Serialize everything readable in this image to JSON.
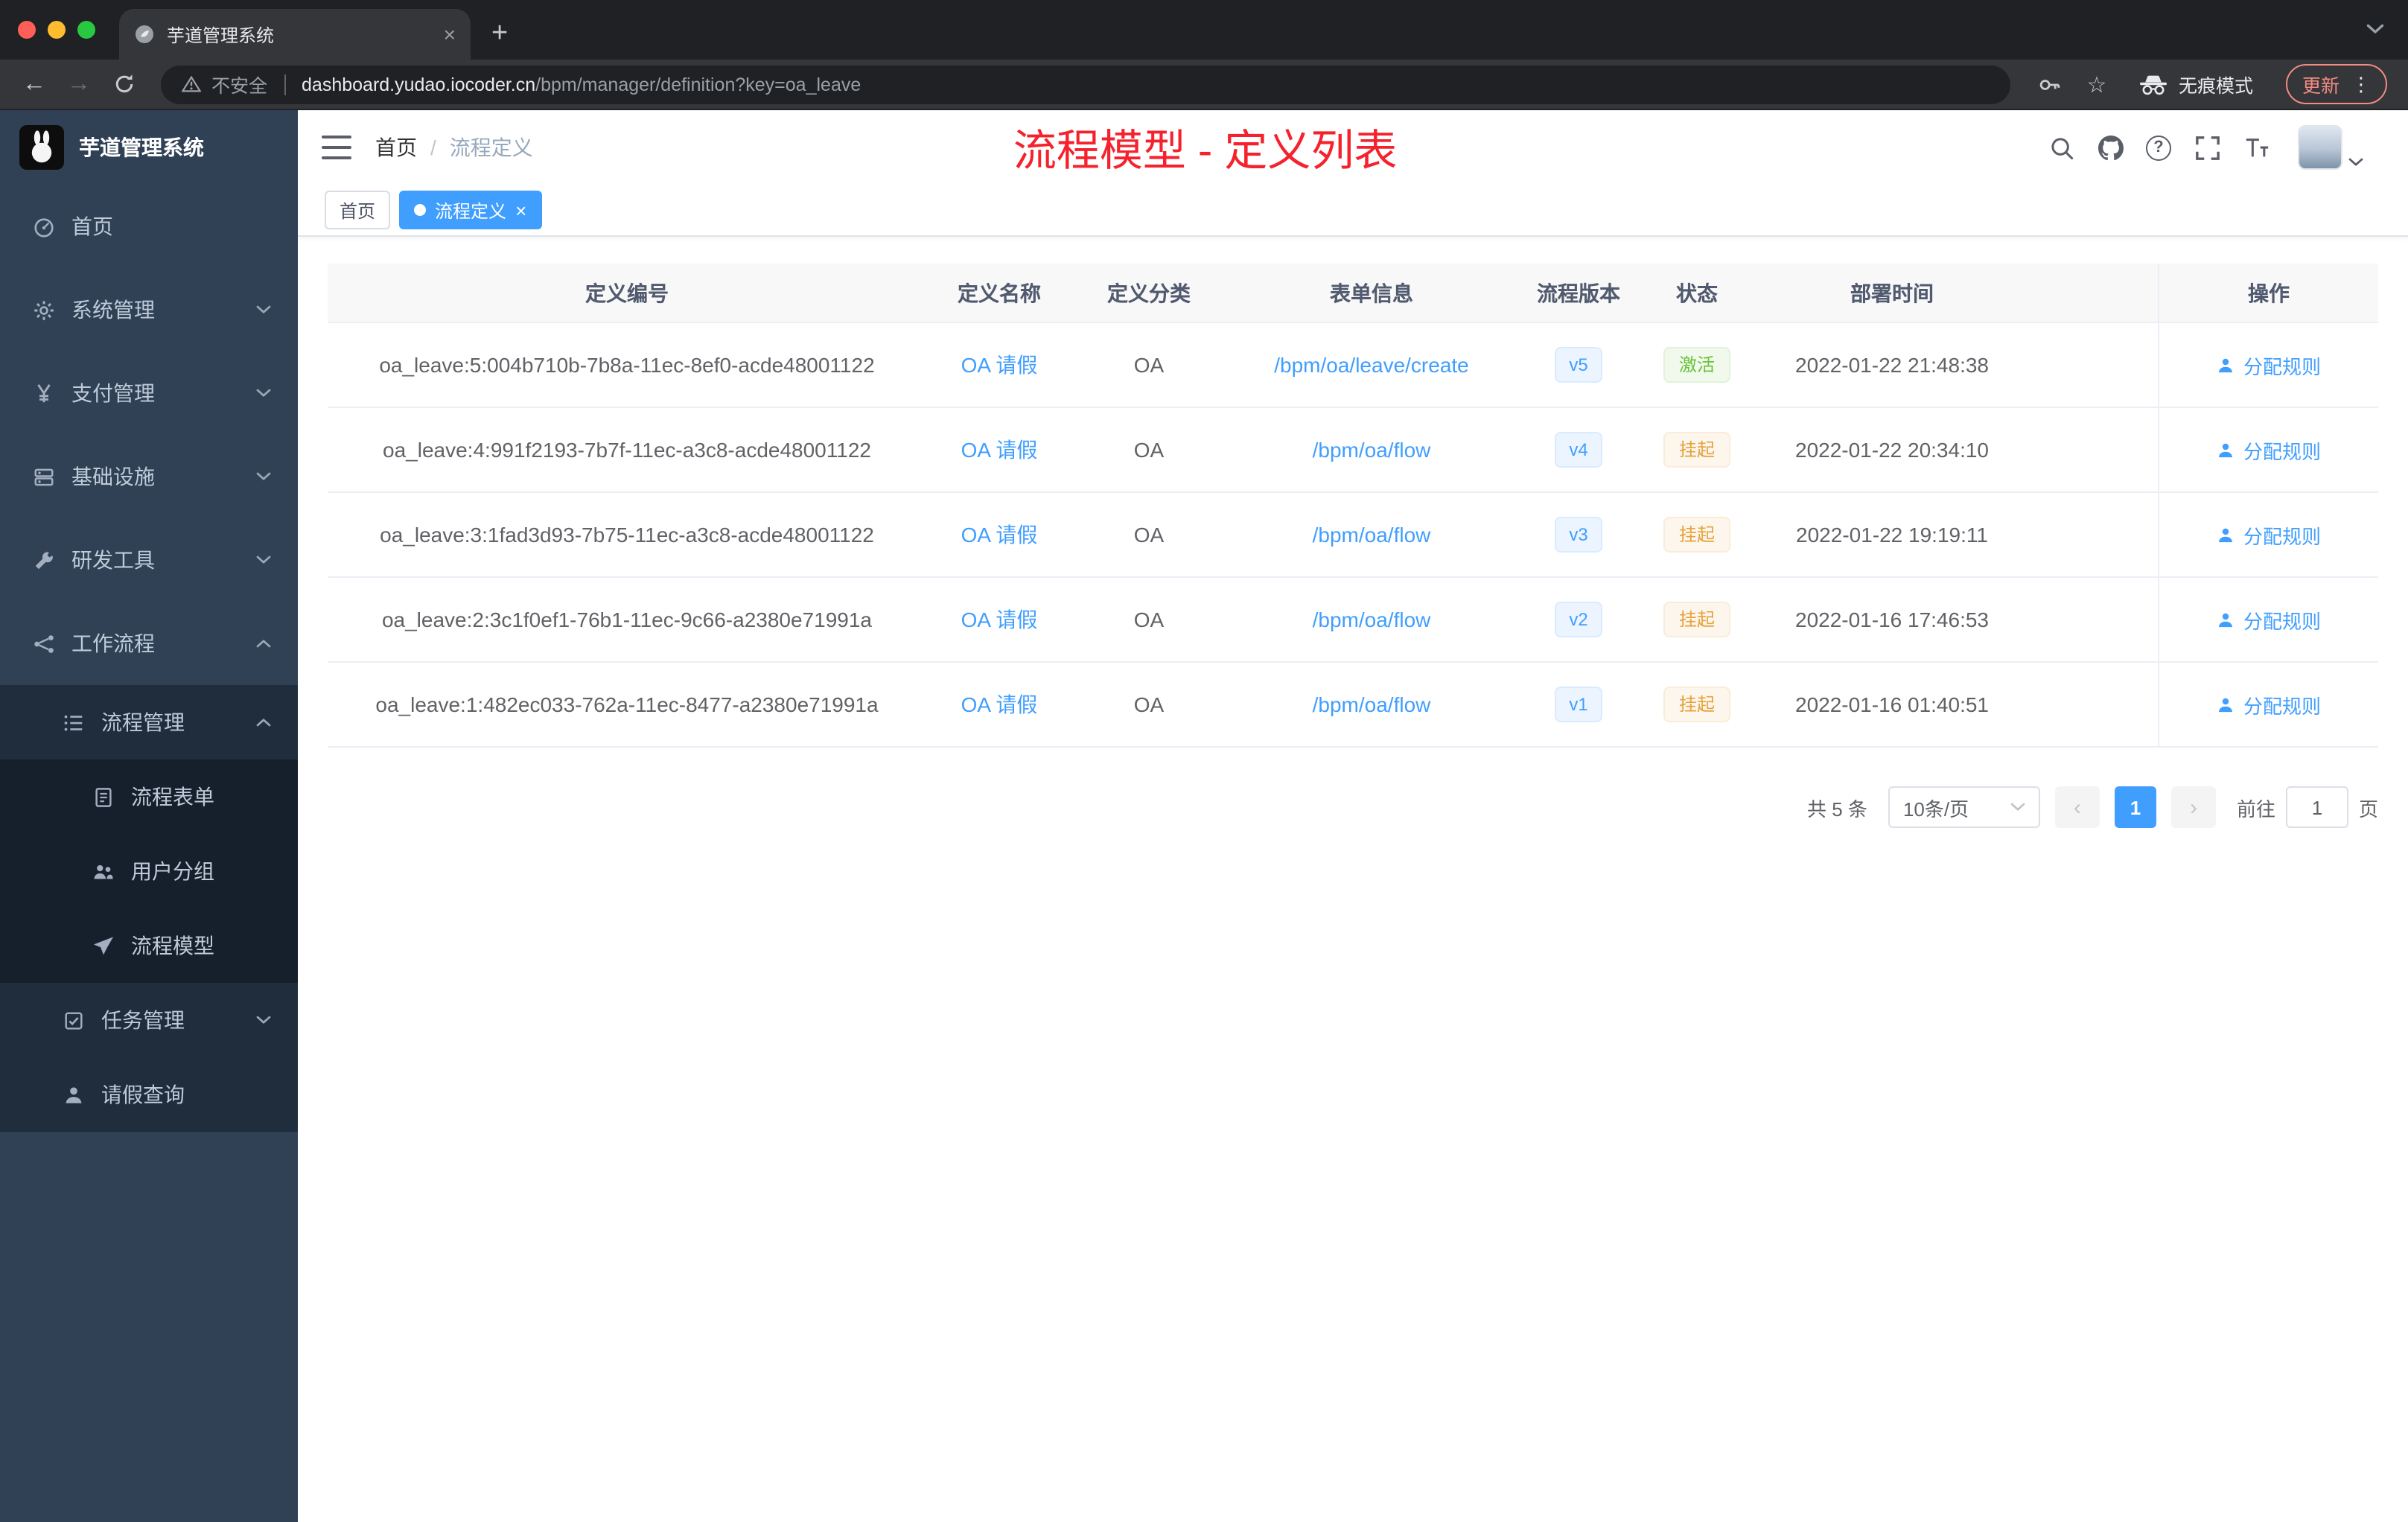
{
  "browser": {
    "tab_title": "芋道管理系统",
    "security_text": "不安全",
    "url_domain": "dashboard.yudao.iocoder.cn",
    "url_path": "/bpm/manager/definition?key=oa_leave",
    "incognito_label": "无痕模式",
    "update_label": "更新"
  },
  "sidebar": {
    "logo_title": "芋道管理系统",
    "items": [
      {
        "key": "home",
        "label": "首页",
        "icon": "dashboard",
        "level": 1,
        "arrow": null
      },
      {
        "key": "system",
        "label": "系统管理",
        "icon": "gear",
        "level": 1,
        "arrow": "down"
      },
      {
        "key": "payment",
        "label": "支付管理",
        "icon": "yen",
        "level": 1,
        "arrow": "down"
      },
      {
        "key": "infrastructure",
        "label": "基础设施",
        "icon": "server",
        "level": 1,
        "arrow": "down"
      },
      {
        "key": "devtools",
        "label": "研发工具",
        "icon": "tool",
        "level": 1,
        "arrow": "down"
      },
      {
        "key": "workflow",
        "label": "工作流程",
        "icon": "workflow",
        "level": 1,
        "arrow": "up"
      },
      {
        "key": "process-management",
        "label": "流程管理",
        "icon": "list",
        "level": 2,
        "arrow": "up"
      },
      {
        "key": "process-form",
        "label": "流程表单",
        "icon": "form",
        "level": 3,
        "arrow": null
      },
      {
        "key": "user-group",
        "label": "用户分组",
        "icon": "group",
        "level": 3,
        "arrow": null
      },
      {
        "key": "process-model",
        "label": "流程模型",
        "icon": "send",
        "level": 3,
        "arrow": null
      },
      {
        "key": "task-management",
        "label": "任务管理",
        "icon": "task",
        "level": 2,
        "arrow": "down"
      },
      {
        "key": "leave-query",
        "label": "请假查询",
        "icon": "person",
        "level": 2,
        "arrow": null
      }
    ]
  },
  "header": {
    "breadcrumb": [
      "首页",
      "流程定义"
    ],
    "separator": "/",
    "annotation": "流程模型 - 定义列表"
  },
  "tags": [
    {
      "label": "首页",
      "active": false
    },
    {
      "label": "流程定义",
      "active": true
    }
  ],
  "table": {
    "columns": [
      "定义编号",
      "定义名称",
      "定义分类",
      "表单信息",
      "流程版本",
      "状态",
      "部署时间",
      "操作"
    ],
    "rows": [
      {
        "id": "oa_leave:5:004b710b-7b8a-11ec-8ef0-acde48001122",
        "name": "OA 请假",
        "category": "OA",
        "form": "/bpm/oa/leave/create",
        "version": "v5",
        "status": "激活",
        "status_type": "success",
        "time": "2022-01-22 21:48:38",
        "action": "分配规则"
      },
      {
        "id": "oa_leave:4:991f2193-7b7f-11ec-a3c8-acde48001122",
        "name": "OA 请假",
        "category": "OA",
        "form": "/bpm/oa/flow",
        "version": "v4",
        "status": "挂起",
        "status_type": "warning",
        "time": "2022-01-22 20:34:10",
        "action": "分配规则"
      },
      {
        "id": "oa_leave:3:1fad3d93-7b75-11ec-a3c8-acde48001122",
        "name": "OA 请假",
        "category": "OA",
        "form": "/bpm/oa/flow",
        "version": "v3",
        "status": "挂起",
        "status_type": "warning",
        "time": "2022-01-22 19:19:11",
        "action": "分配规则"
      },
      {
        "id": "oa_leave:2:3c1f0ef1-76b1-11ec-9c66-a2380e71991a",
        "name": "OA 请假",
        "category": "OA",
        "form": "/bpm/oa/flow",
        "version": "v2",
        "status": "挂起",
        "status_type": "warning",
        "time": "2022-01-16 17:46:53",
        "action": "分配规则"
      },
      {
        "id": "oa_leave:1:482ec033-762a-11ec-8477-a2380e71991a",
        "name": "OA 请假",
        "category": "OA",
        "form": "/bpm/oa/flow",
        "version": "v1",
        "status": "挂起",
        "status_type": "warning",
        "time": "2022-01-16 01:40:51",
        "action": "分配规则"
      }
    ]
  },
  "pagination": {
    "total": "共 5 条",
    "page_size": "10条/页",
    "current_page": "1",
    "goto_prefix": "前往",
    "goto_value": "1",
    "goto_suffix": "页"
  },
  "colors": {
    "accent": "#409eff",
    "annotation_red": "#f5222d",
    "success": "#67c23a",
    "warning": "#e6a23c",
    "sidebar_bg": "#304156"
  }
}
